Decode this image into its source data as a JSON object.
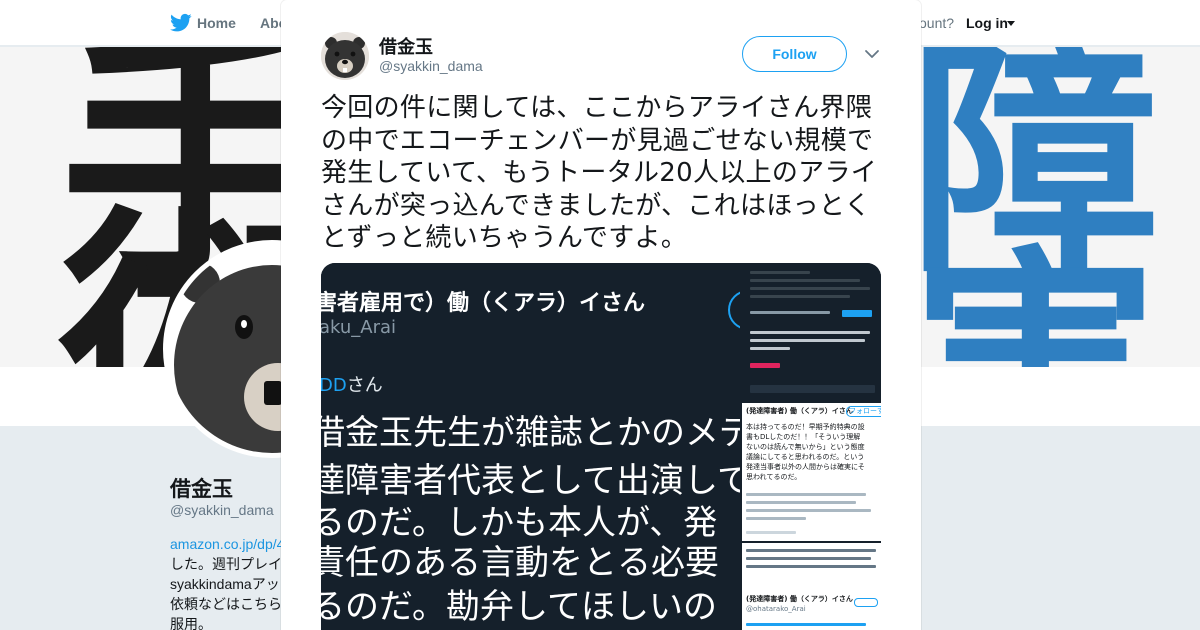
{
  "topbar": {
    "home_label": "Home",
    "about_label": "Abo",
    "have_account": "ccount?",
    "login_label": "Log in"
  },
  "banner": {
    "char_1": "手",
    "char_2": "術",
    "char_3": "障",
    "char_4": "害"
  },
  "profile": {
    "name": "借金玉",
    "handle": "@syakkin_dama",
    "bio_lines": {
      "link": "amazon.co.jp/dp/4",
      "line_1": "した。週刊プレイ",
      "line_2": "syakkindamaアッ",
      "line_3": "依頼などはこちら",
      "line_4": "服用。"
    }
  },
  "tweet": {
    "author_name": "借金玉",
    "author_handle": "@syakkin_dama",
    "follow_label": "Follow",
    "text": "今回の件に関しては、ここからアライさん界隈の中でエコーチェンバーが見過ごせない規模で発生していて、もうトータル20人以上のアライさんが突っ込んできましたが、これはほっとくとずっと続いちゃうんですよ。"
  },
  "media": {
    "main": {
      "display_name": "害者雇用で）働（くアラ）イさん",
      "handle": "aku_Arai",
      "reply_to_handle": "DD",
      "reply_to_suffix": "さん",
      "body_1": "借金玉先生が雑誌とかのメデ",
      "body_2": "達障害者代表として出演して",
      "body_3": "るのだ。しかも本人が、発",
      "body_4": "責任のある言動をとる必要",
      "body_5": "るのだ。勘弁してほしいの"
    },
    "thumb_2": {
      "name": "(発達障害者) 働（くアラ）イさん",
      "follow": "フォローする",
      "body_1": "本は持ってるのだ！早期予約特典の設",
      "body_2": "書もDLしたのだ！！「そういう理解",
      "body_3": "ないのは読んで無いから」という態度",
      "body_4": "議論にしてると思われるのだ。という",
      "body_5": "発達当事者以外の人間からは確実にそ",
      "body_6": "思われてるのだ。"
    },
    "thumb_3": {
      "name": "(発達障害者) 働（くアラ）イさん",
      "sub": "@ohatarako_Arai"
    }
  },
  "colors": {
    "accent": "#1da1f2",
    "dark_card": "#15202b",
    "banner_blue": "#2f7fc1"
  },
  "icons": {
    "topbar_logo": "twitter-bird-icon",
    "close": "close-icon",
    "more": "chevron-down-icon"
  }
}
